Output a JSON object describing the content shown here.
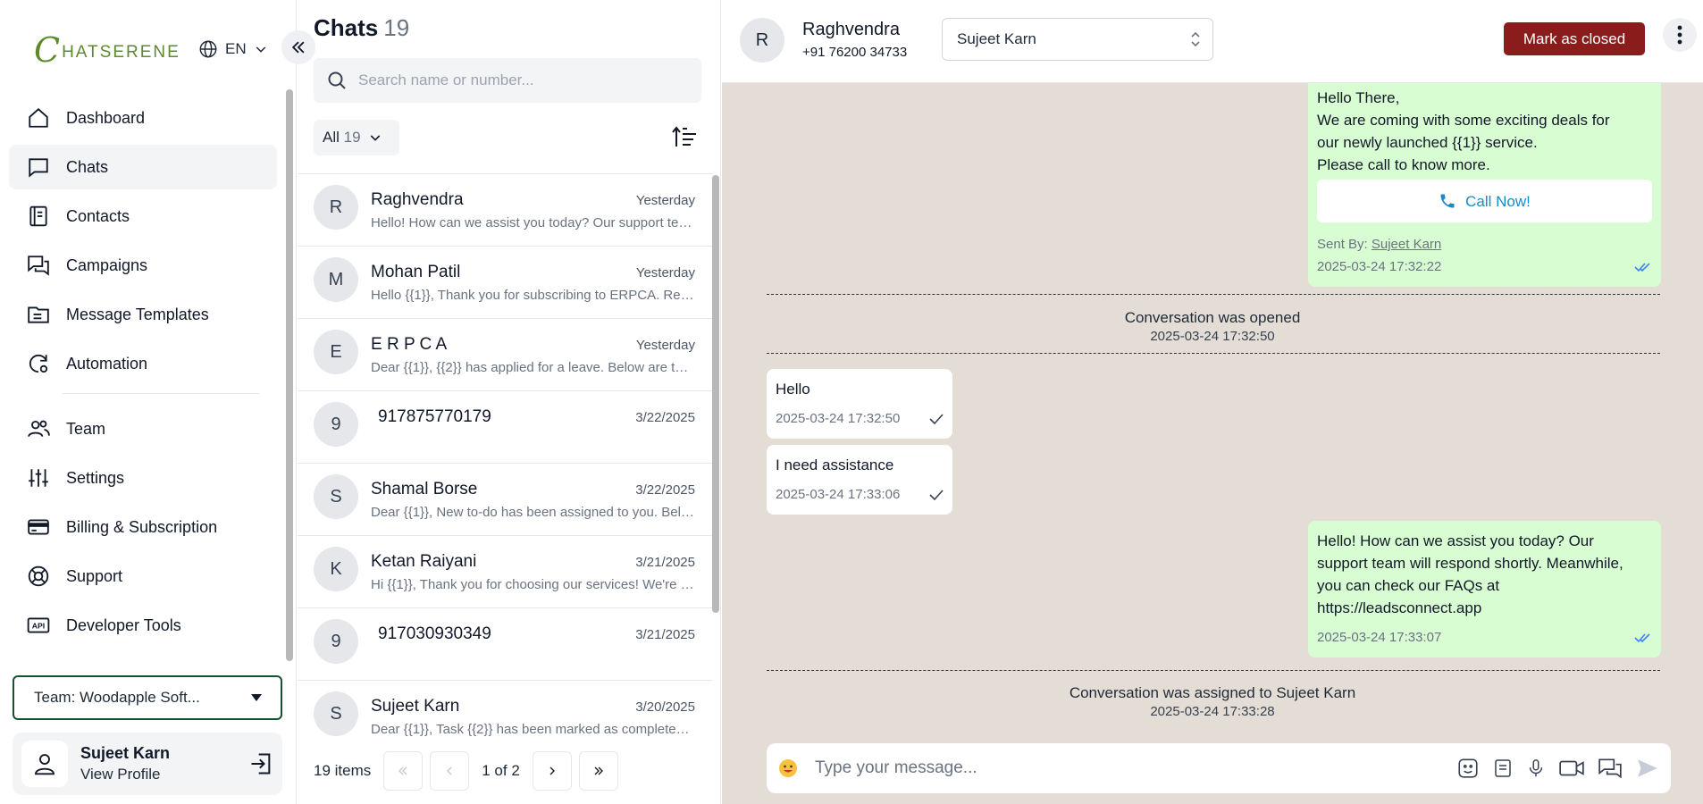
{
  "brand": {
    "name": "CHATSERENE"
  },
  "lang": {
    "code": "EN"
  },
  "nav": [
    {
      "label": "Dashboard",
      "icon": "home-icon"
    },
    {
      "label": "Chats",
      "icon": "chat-icon",
      "active": true
    },
    {
      "label": "Contacts",
      "icon": "contacts-icon"
    },
    {
      "label": "Campaigns",
      "icon": "campaigns-icon"
    },
    {
      "label": "Message Templates",
      "icon": "folder-icon"
    },
    {
      "label": "Automation",
      "icon": "automation-icon"
    },
    {
      "label": "Team",
      "icon": "team-icon"
    },
    {
      "label": "Settings",
      "icon": "sliders-icon"
    },
    {
      "label": "Billing & Subscription",
      "icon": "card-icon"
    },
    {
      "label": "Support",
      "icon": "lifebuoy-icon"
    },
    {
      "label": "Developer Tools",
      "icon": "api-icon"
    }
  ],
  "team": {
    "label": "Team: Woodapple Soft..."
  },
  "profile": {
    "name": "Sujeet Karn",
    "link": "View Profile"
  },
  "chatlist": {
    "title": "Chats",
    "count": "19",
    "search_placeholder": "Search name or number...",
    "filter_label": "All",
    "filter_count": "19",
    "items": [
      {
        "initial": "R",
        "name": "Raghvendra",
        "date": "Yesterday",
        "preview": "Hello! How can we assist you today? Our support team will respond shortly."
      },
      {
        "initial": "M",
        "name": "Mohan Patil",
        "date": "Yesterday",
        "preview": "Hello {{1}}, Thank you for subscribing to ERPCA. Regards"
      },
      {
        "initial": "E",
        "name": "E R P C A",
        "date": "Yesterday",
        "preview": "Dear {{1}}, {{2}} has applied for a leave. Below are the details"
      },
      {
        "initial": "9",
        "name": "917875770179",
        "date": "3/22/2025",
        "preview": ""
      },
      {
        "initial": "S",
        "name": "Shamal Borse",
        "date": "3/22/2025",
        "preview": "Dear {{1}}, New to-do has been assigned to you. Below are details"
      },
      {
        "initial": "K",
        "name": "Ketan Raiyani",
        "date": "3/21/2025",
        "preview": "Hi {{1}}, Thank you for choosing our services! We're happy to help"
      },
      {
        "initial": "9",
        "name": "917030930349",
        "date": "3/21/2025",
        "preview": ""
      },
      {
        "initial": "S",
        "name": "Sujeet Karn",
        "date": "3/20/2025",
        "preview": "Dear {{1}}, Task {{2}} has been marked as completed by the assignee"
      }
    ],
    "pager": {
      "items": "19 items",
      "page": "1 of 2"
    }
  },
  "conversation": {
    "initial": "R",
    "name": "Raghvendra",
    "phone": "+91 76200 34733",
    "assignee": "Sujeet Karn",
    "close_label": "Mark as closed",
    "template_msg": {
      "lines": [
        "Hello There,",
        "We are coming with some exciting deals for",
        "our newly launched {{1}} service.",
        "Please call to know more."
      ],
      "button": "Call Now!",
      "sent_by_label": "Sent By:",
      "sent_by": "Sujeet Karn",
      "time": "2025-03-24 17:32:22"
    },
    "sys1": {
      "text": "Conversation was opened",
      "time": "2025-03-24 17:32:50"
    },
    "in1": {
      "text": "Hello",
      "time": "2025-03-24 17:32:50"
    },
    "in2": {
      "text": "I need assistance",
      "time": "2025-03-24 17:33:06"
    },
    "out2": {
      "lines": [
        "Hello! How can we assist you today? Our",
        "support team will respond shortly. Meanwhile,",
        "you can check our FAQs at",
        "https://leadsconnect.app"
      ],
      "time": "2025-03-24 17:33:07"
    },
    "sys2": {
      "text": "Conversation was assigned to Sujeet Karn",
      "time": "2025-03-24 17:33:28"
    },
    "composer_placeholder": "Type your message..."
  },
  "colors": {
    "brand": "#5e8a2c",
    "close_button": "#8b1c1c",
    "outgoing_bubble": "#d9fdd3",
    "chat_bg": "#e4ddd5",
    "tick_blue": "#3b82f6"
  }
}
